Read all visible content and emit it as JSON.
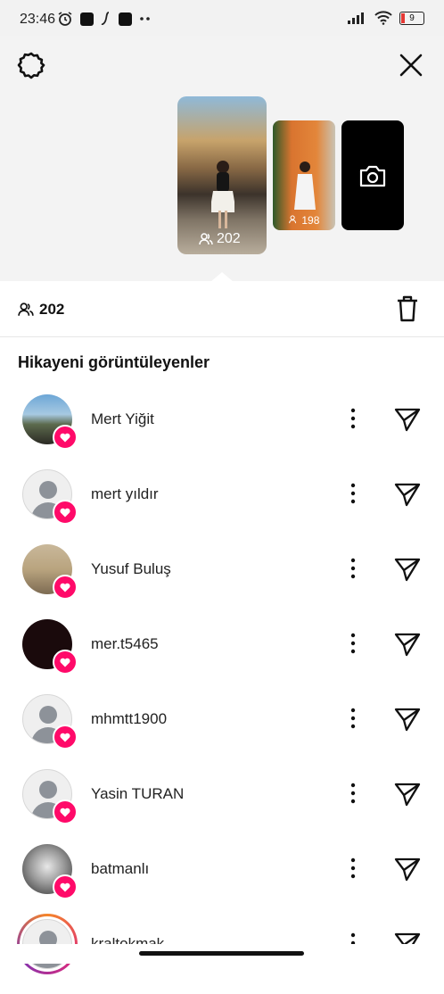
{
  "status_bar": {
    "time": "23:46",
    "battery": "9"
  },
  "stories": {
    "main_count": "202",
    "second_count": "198"
  },
  "viewer_bar": {
    "count": "202"
  },
  "list": {
    "title": "Hikayeni görüntüleyenler"
  },
  "viewers": [
    {
      "name": "Mert Yiğit",
      "avatar": "photo-landscape"
    },
    {
      "name": "mert yıldır",
      "avatar": "default"
    },
    {
      "name": "Yusuf Buluş",
      "avatar": "photo-street"
    },
    {
      "name": "mer.t5465",
      "avatar": "dark"
    },
    {
      "name": "mhmtt1900",
      "avatar": "default"
    },
    {
      "name": "Yasin TURAN",
      "avatar": "default"
    },
    {
      "name": "batmanlı",
      "avatar": "photo-bw"
    },
    {
      "name": "kraltokmak",
      "avatar": "default-story-ring"
    }
  ],
  "colors": {
    "heart_badge": "#ff0a69",
    "panel_bg": "#f3f3f3"
  },
  "icons": [
    "settings-gear-icon",
    "close-icon",
    "camera-icon",
    "viewers-icon",
    "trash-icon",
    "heart-icon",
    "more-vertical-icon",
    "send-icon"
  ]
}
